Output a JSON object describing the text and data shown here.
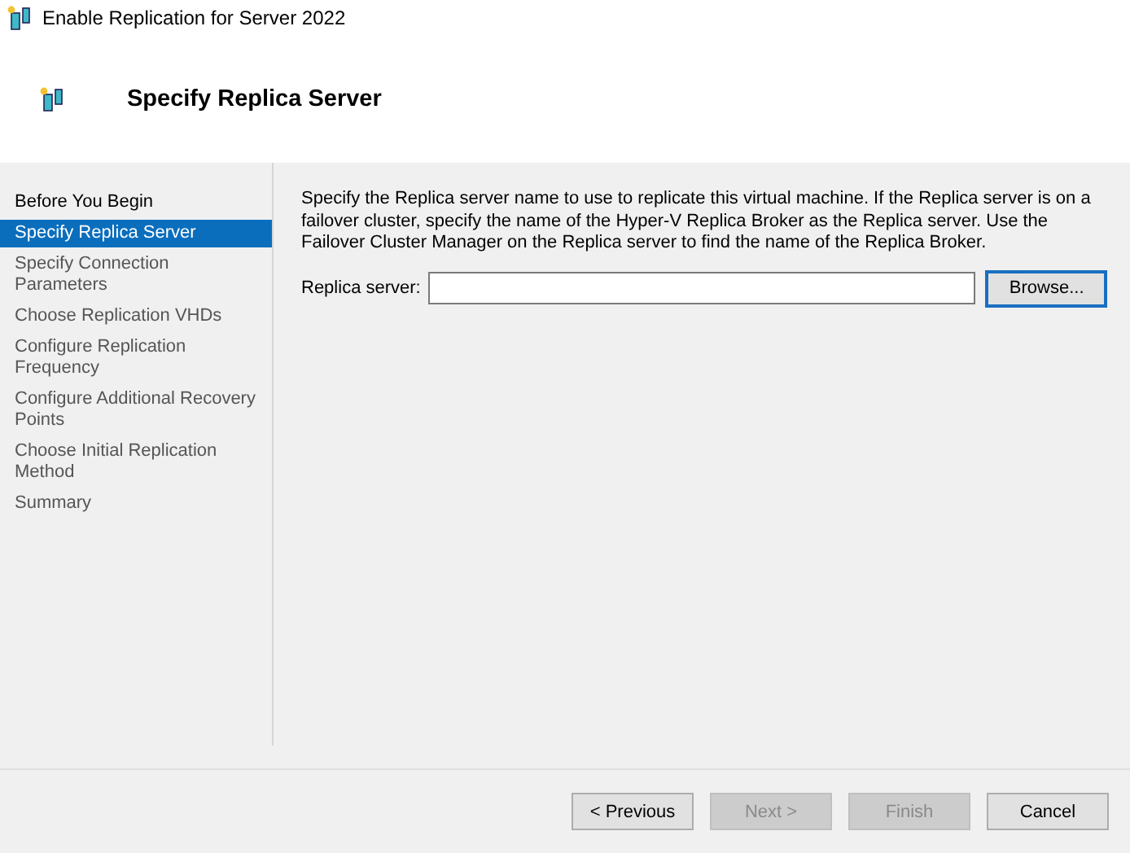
{
  "window": {
    "title": "Enable Replication for Server 2022"
  },
  "header": {
    "title": "Specify Replica Server"
  },
  "sidebar": {
    "items": [
      {
        "label": "Before You Begin",
        "selected": false,
        "dimmed": false
      },
      {
        "label": "Specify Replica Server",
        "selected": true,
        "dimmed": false
      },
      {
        "label": "Specify Connection Parameters",
        "selected": false,
        "dimmed": true
      },
      {
        "label": "Choose Replication VHDs",
        "selected": false,
        "dimmed": true
      },
      {
        "label": "Configure Replication Frequency",
        "selected": false,
        "dimmed": true
      },
      {
        "label": "Configure Additional Recovery Points",
        "selected": false,
        "dimmed": true
      },
      {
        "label": "Choose Initial Replication Method",
        "selected": false,
        "dimmed": true
      },
      {
        "label": "Summary",
        "selected": false,
        "dimmed": true
      }
    ]
  },
  "content": {
    "description": "Specify the Replica server name to use to replicate this virtual machine. If the Replica server is on a failover cluster, specify the name of the Hyper-V Replica Broker as the Replica server. Use the Failover Cluster Manager on the Replica server to find the name of the Replica Broker.",
    "field_label": "Replica server:",
    "browse_button": "Browse..."
  },
  "buttons": [
    {
      "label": "< Previous",
      "disabled": false
    },
    {
      "label": "Next >",
      "disabled": true
    },
    {
      "label": "Finish",
      "disabled": true
    },
    {
      "label": "Cancel",
      "disabled": false
    }
  ]
}
